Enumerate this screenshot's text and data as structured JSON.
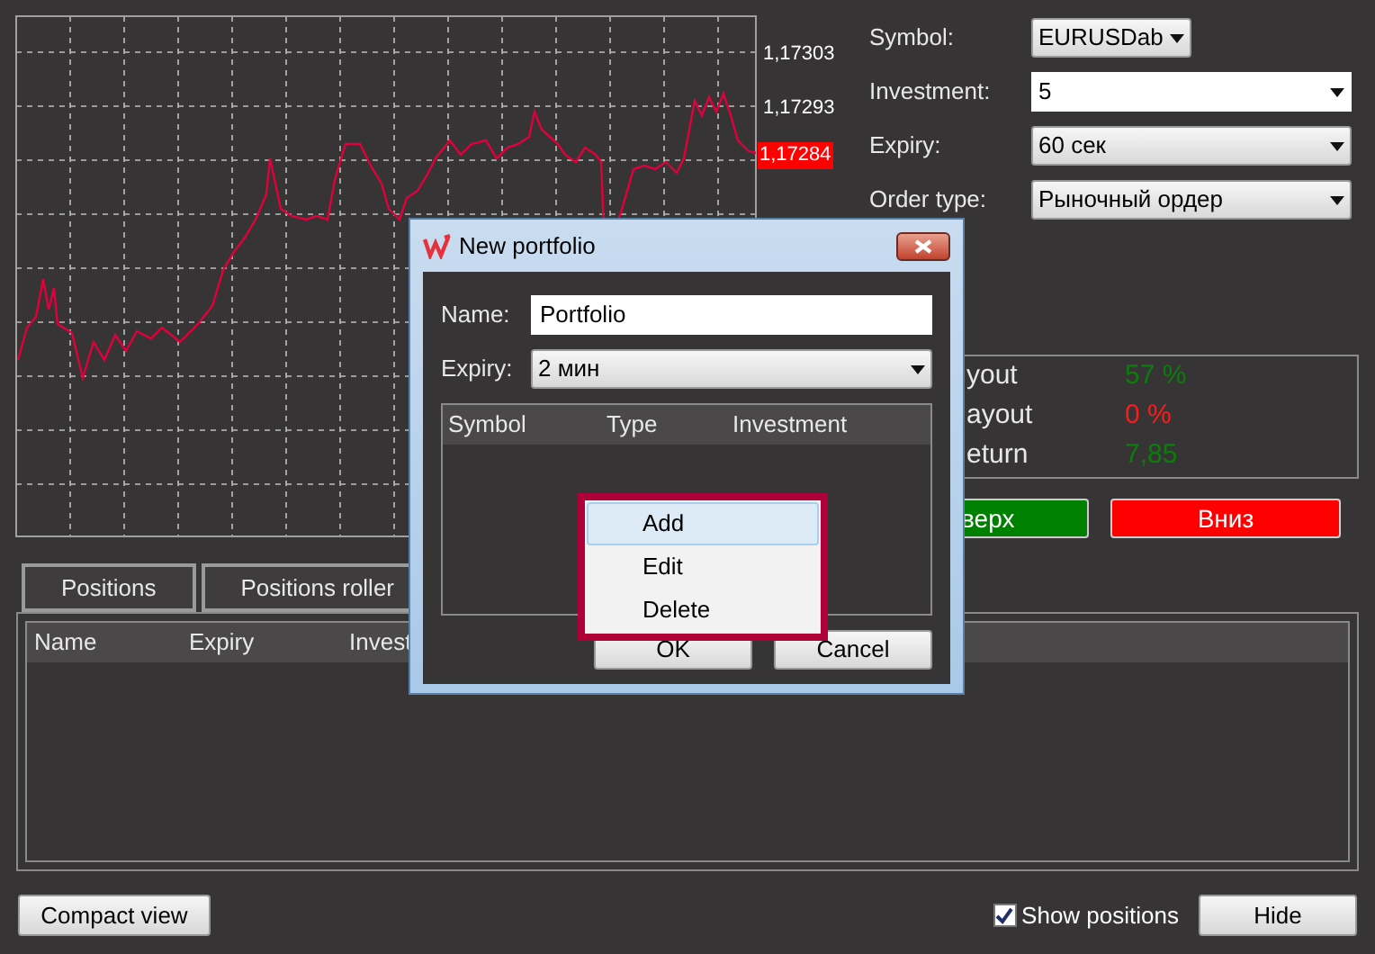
{
  "chart": {
    "axis_labels": [
      "1,17303",
      "1,17293"
    ],
    "current_price": "1,17284"
  },
  "order_form": [
    {
      "label": "Symbol:",
      "value": "EURUSDab",
      "kind": "dropdown"
    },
    {
      "label": "Investment:",
      "value": "5",
      "kind": "editable"
    },
    {
      "label": "Expiry:",
      "value": "60 сек",
      "kind": "combo"
    },
    {
      "label": "Order type:",
      "value": "Рыночный ордер",
      "kind": "combo"
    }
  ],
  "stats": [
    {
      "label": "yout",
      "value": "57 %",
      "color": "#0b7d0b"
    },
    {
      "label": "ayout",
      "value": "0 %",
      "color": "#ff1a1a"
    },
    {
      "label": "eturn",
      "value": "7,85",
      "color": "#0b7d0b"
    }
  ],
  "trade_buttons": [
    {
      "label": "верх",
      "color": "#008000"
    },
    {
      "label": "Вниз",
      "color": "#ff0000"
    }
  ],
  "tabs": [
    {
      "label": "Positions",
      "selected": false
    },
    {
      "label": "Positions roller",
      "selected": false
    }
  ],
  "positions_table": {
    "columns": [
      "Name",
      "Expiry",
      "Invest"
    ]
  },
  "bottom_bar": {
    "compact_button": "Compact view",
    "show_positions": {
      "label": "Show positions",
      "checked": true
    },
    "hide_button": "Hide"
  },
  "dialog": {
    "title": "New portfolio",
    "name_label": "Name:",
    "name_value": "Portfolio",
    "expiry_label": "Expiry:",
    "expiry_value": "2 мин",
    "columns": [
      "Symbol",
      "Type",
      "Investment"
    ],
    "buttons": [
      "OK",
      "Cancel"
    ],
    "context_menu": [
      {
        "label": "Add",
        "selected": true
      },
      {
        "label": "Edit",
        "selected": false
      },
      {
        "label": "Delete",
        "selected": false
      }
    ]
  }
}
